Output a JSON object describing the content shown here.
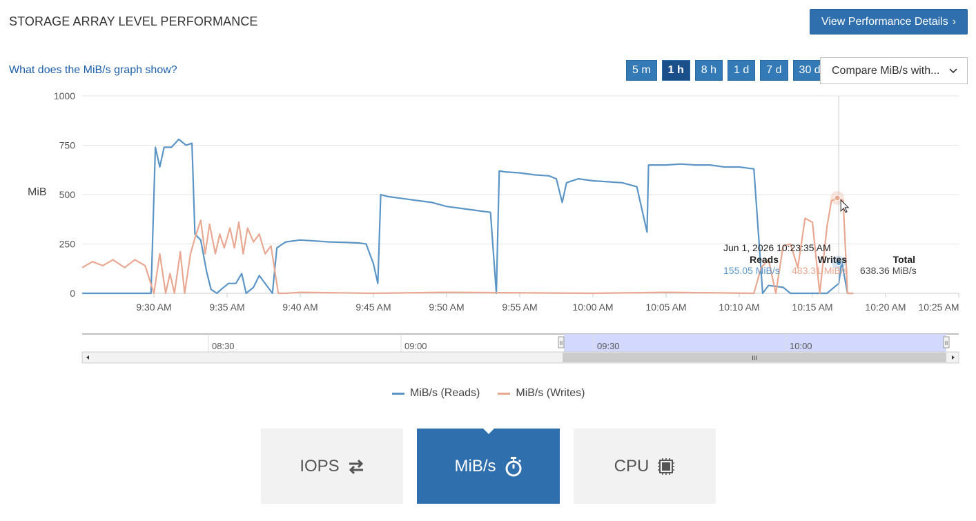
{
  "header": {
    "title": "STORAGE ARRAY LEVEL PERFORMANCE",
    "details_label": "View Performance Details"
  },
  "help_link": "What does the MiB/s graph show?",
  "ranges": [
    {
      "label": "5 m",
      "active": false
    },
    {
      "label": "1 h",
      "active": true
    },
    {
      "label": "8 h",
      "active": false
    },
    {
      "label": "1 d",
      "active": false
    },
    {
      "label": "7 d",
      "active": false
    },
    {
      "label": "30 d",
      "active": false
    }
  ],
  "compare": {
    "label": "Compare MiB/s with..."
  },
  "colors": {
    "reads": "#5b95c6",
    "writes": "#e8a892",
    "accent": "#2f6fad",
    "navigator": "#d3d8ff"
  },
  "chart_data": {
    "type": "line",
    "ylabel": "MiB",
    "ylim": [
      0,
      1000
    ],
    "yticks": [
      "1000",
      "750",
      "500",
      "250",
      "0"
    ],
    "xticks": [
      "9:30 AM",
      "9:35 AM",
      "9:40 AM",
      "9:45 AM",
      "9:50 AM",
      "9:55 AM",
      "10:00 AM",
      "10:05 AM",
      "10:10 AM",
      "10:15 AM",
      "10:20 AM",
      "10:25 AM"
    ],
    "x_minutes_from_9_30": {
      "start": -4.9,
      "end": 7.7
    },
    "series": [
      {
        "name": "MiB/s (Reads)",
        "points": [
          [
            -4.9,
            0
          ],
          [
            -0.2,
            0
          ],
          [
            0.1,
            740
          ],
          [
            0.4,
            640
          ],
          [
            0.7,
            740
          ],
          [
            1.2,
            740
          ],
          [
            1.7,
            780
          ],
          [
            2.2,
            750
          ],
          [
            2.6,
            760
          ],
          [
            2.8,
            300
          ],
          [
            3.2,
            270
          ],
          [
            3.6,
            110
          ],
          [
            3.9,
            20
          ],
          [
            4.3,
            0
          ],
          [
            4.6,
            20
          ],
          [
            5.1,
            50
          ],
          [
            5.6,
            50
          ],
          [
            6.0,
            100
          ],
          [
            6.3,
            0
          ],
          [
            6.8,
            30
          ],
          [
            7.2,
            90
          ],
          [
            8.1,
            0
          ],
          [
            8.4,
            230
          ],
          [
            9.0,
            260
          ],
          [
            10.0,
            270
          ],
          [
            11.0,
            265
          ],
          [
            12.0,
            260
          ],
          [
            13.0,
            258
          ],
          [
            14.0,
            255
          ],
          [
            14.5,
            250
          ],
          [
            15.0,
            150
          ],
          [
            15.3,
            50
          ],
          [
            15.5,
            500
          ],
          [
            16.0,
            490
          ],
          [
            17.0,
            480
          ],
          [
            18.0,
            470
          ],
          [
            19.0,
            460
          ],
          [
            20.0,
            440
          ],
          [
            21.0,
            430
          ],
          [
            22.0,
            420
          ],
          [
            23.0,
            410
          ],
          [
            23.4,
            0
          ],
          [
            23.6,
            620
          ],
          [
            24.0,
            615
          ],
          [
            25.0,
            610
          ],
          [
            26.0,
            600
          ],
          [
            27.0,
            595
          ],
          [
            27.5,
            580
          ],
          [
            27.9,
            460
          ],
          [
            28.2,
            560
          ],
          [
            29.0,
            580
          ],
          [
            30.0,
            570
          ],
          [
            31.0,
            565
          ],
          [
            32.0,
            560
          ],
          [
            33.0,
            540
          ],
          [
            33.7,
            310
          ],
          [
            33.8,
            650
          ],
          [
            35.0,
            650
          ],
          [
            36.0,
            655
          ],
          [
            37.0,
            650
          ],
          [
            38.0,
            650
          ],
          [
            39.0,
            640
          ],
          [
            40.0,
            640
          ],
          [
            41.0,
            630
          ],
          [
            41.6,
            0
          ],
          [
            42.0,
            40
          ],
          [
            43.0,
            30
          ],
          [
            43.5,
            0
          ],
          [
            44.0,
            0
          ],
          [
            45.0,
            0
          ],
          [
            46.0,
            0
          ],
          [
            46.8,
            50
          ],
          [
            47.0,
            160
          ],
          [
            47.4,
            0
          ],
          [
            47.8,
            0
          ]
        ],
        "tooltip_value": "155.05 MiB/s"
      },
      {
        "name": "MiB/s (Writes)",
        "points": [
          [
            -4.9,
            130
          ],
          [
            -4.2,
            160
          ],
          [
            -3.5,
            140
          ],
          [
            -2.8,
            170
          ],
          [
            -2.0,
            130
          ],
          [
            -1.3,
            170
          ],
          [
            -0.6,
            140
          ],
          [
            0,
            0
          ],
          [
            0.4,
            200
          ],
          [
            0.8,
            0
          ],
          [
            1.1,
            100
          ],
          [
            1.4,
            0
          ],
          [
            1.8,
            210
          ],
          [
            2.1,
            0
          ],
          [
            2.5,
            200
          ],
          [
            2.8,
            280
          ],
          [
            3.2,
            370
          ],
          [
            3.5,
            200
          ],
          [
            3.8,
            350
          ],
          [
            4.2,
            200
          ],
          [
            4.5,
            300
          ],
          [
            4.8,
            230
          ],
          [
            5.2,
            330
          ],
          [
            5.5,
            230
          ],
          [
            5.8,
            360
          ],
          [
            6.1,
            200
          ],
          [
            6.4,
            330
          ],
          [
            6.8,
            260
          ],
          [
            7.2,
            300
          ],
          [
            7.6,
            200
          ],
          [
            8.0,
            240
          ],
          [
            8.5,
            0
          ],
          [
            9.0,
            0
          ],
          [
            10.0,
            5
          ],
          [
            15.0,
            0
          ],
          [
            20.0,
            5
          ],
          [
            30.0,
            0
          ],
          [
            35.0,
            5
          ],
          [
            41.0,
            0
          ],
          [
            41.5,
            130
          ],
          [
            42.0,
            170
          ],
          [
            42.5,
            0
          ],
          [
            43.0,
            240
          ],
          [
            43.5,
            250
          ],
          [
            44.0,
            130
          ],
          [
            44.5,
            380
          ],
          [
            45.0,
            360
          ],
          [
            45.5,
            0
          ],
          [
            46.0,
            340
          ],
          [
            46.3,
            470
          ],
          [
            46.8,
            480
          ],
          [
            47.1,
            470
          ],
          [
            47.4,
            0
          ],
          [
            47.8,
            0
          ]
        ],
        "tooltip_value": "483.31 MiB/s"
      }
    ],
    "tooltip": {
      "timestamp": "Jun 1, 2026 10:23:35 AM",
      "headers": [
        "Reads",
        "Writes",
        "Total"
      ],
      "total_value": "638.36 MiB/s"
    },
    "grid": true,
    "legend_position": "bottom"
  },
  "navigator": {
    "ticks": [
      "08:30",
      "09:00",
      "09:30",
      "10:00"
    ],
    "handle_glyph": "II",
    "scroll_glyph": "III"
  },
  "legend": [
    {
      "label": "MiB/s (Reads)"
    },
    {
      "label": "MiB/s (Writes)"
    }
  ],
  "tabs": [
    {
      "label": "IOPS",
      "icon": "transfer-arrows-icon",
      "active": false
    },
    {
      "label": "MiB/s",
      "icon": "stopwatch-icon",
      "active": true
    },
    {
      "label": "CPU",
      "icon": "chip-icon",
      "active": false
    }
  ]
}
